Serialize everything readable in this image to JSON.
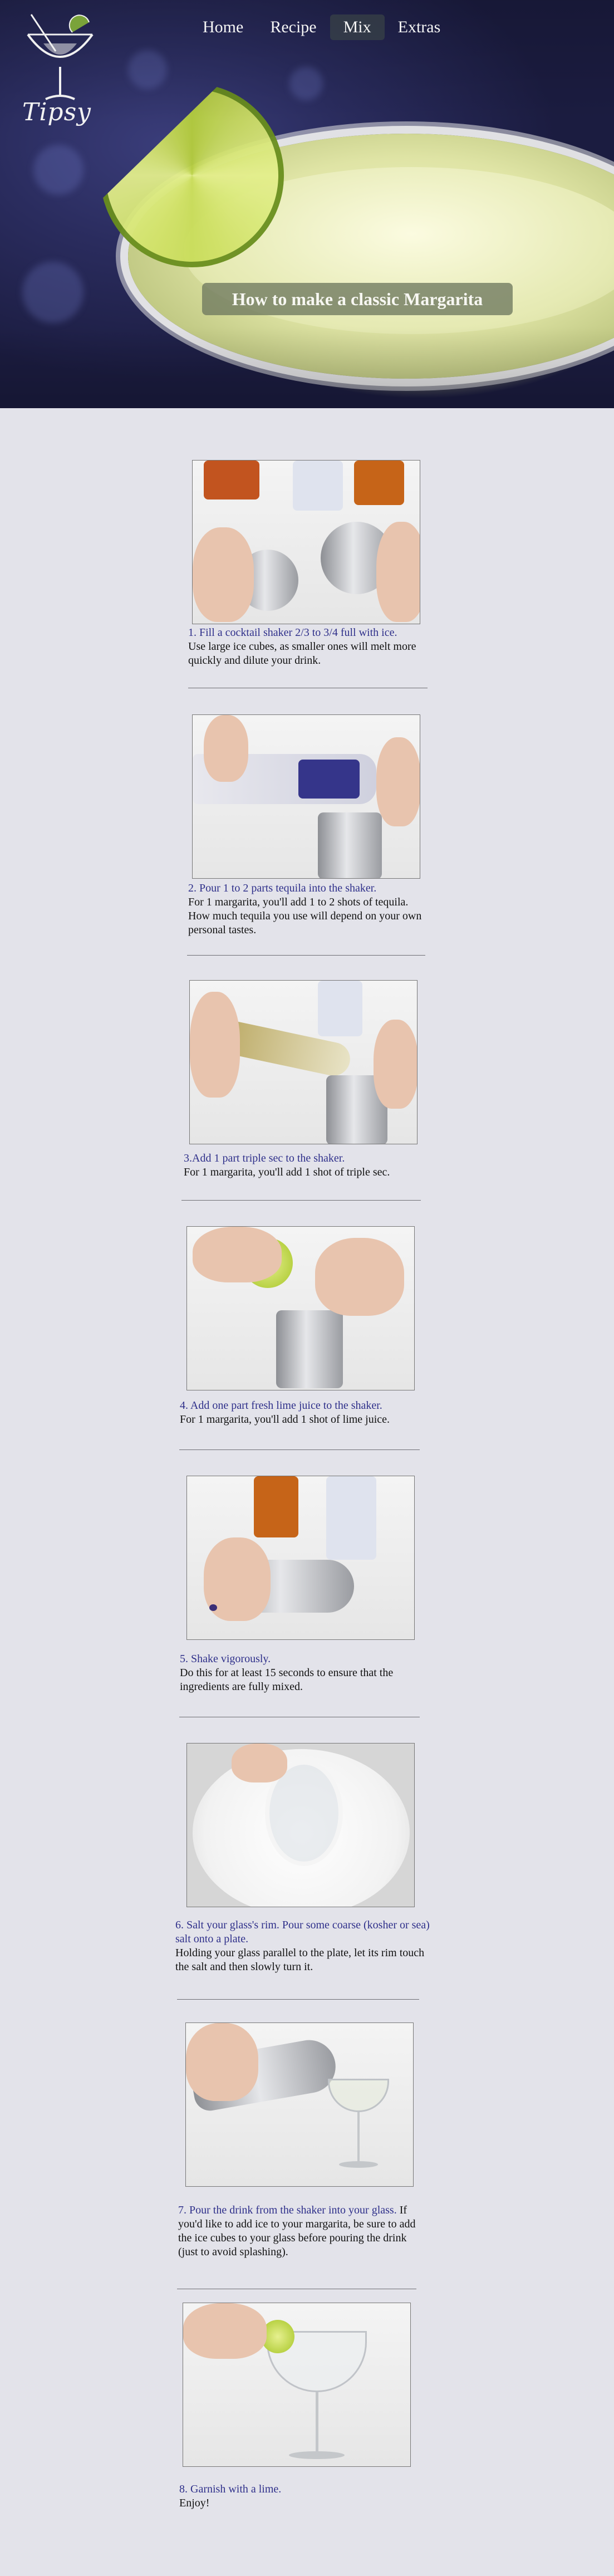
{
  "brand": {
    "logo_text": "Tipsy"
  },
  "nav": {
    "items": [
      {
        "label": "Home",
        "active": false
      },
      {
        "label": "Recipe",
        "active": false
      },
      {
        "label": "Mix",
        "active": true
      },
      {
        "label": "Extras",
        "active": false
      }
    ]
  },
  "hero": {
    "title": "How to make a classic Margarita"
  },
  "steps": [
    {
      "heading": "1. Fill a cocktail shaker 2/3 to 3/4 full with ice.",
      "body": "Use large ice cubes, as smaller ones will melt more quickly and dilute your drink."
    },
    {
      "heading": "2. Pour 1 to 2 parts tequila into the shaker.",
      "body": "For 1 margarita, you'll add 1 to 2 shots of tequila. How much tequila you use will depend on your own personal tastes."
    },
    {
      "heading": "3.Add 1 part triple sec to the shaker.",
      "body": "For 1 margarita, you'll add 1 shot of triple sec."
    },
    {
      "heading": "4. Add one part fresh lime juice to the shaker.",
      "body": "For 1 margarita, you'll add 1 shot of lime juice."
    },
    {
      "heading": "5. Shake vigorously.",
      "body": "Do this for at least 15 seconds to ensure that the ingredients are fully mixed."
    },
    {
      "heading": "6. Salt your glass's rim. Pour some coarse (kosher or sea) salt onto a plate.",
      "body": "Holding your glass parallel to the plate, let its rim touch the salt and then slowly turn it."
    },
    {
      "heading": "7. Pour the drink from the shaker into your glass.",
      "body": "If you'd like to add ice to your margarita, be sure to add the ice cubes to your glass before pouring the drink (just to avoid splashing)."
    },
    {
      "heading": "8. Garnish with a lime.",
      "body": "Enjoy!"
    }
  ]
}
